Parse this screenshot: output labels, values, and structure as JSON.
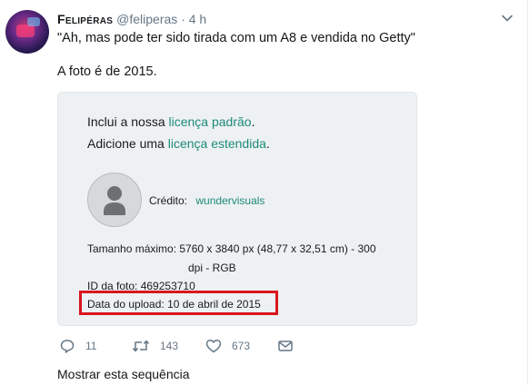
{
  "tweet": {
    "author_name": "Felipéras",
    "handle": "@feliperas",
    "separator": "·",
    "time": "4 h",
    "text_line1": "\"Ah, mas pode ter sido tirada com um A8 e vendida no Getty\"",
    "text_line2": "A foto é de 2015."
  },
  "card": {
    "license_line1_prefix": "Inclui a nossa ",
    "license_line1_link": "licença padrão",
    "license_line1_suffix": ".",
    "license_line2_prefix": "Adicione uma ",
    "license_line2_link": "licença estendida",
    "license_line2_suffix": ".",
    "credit_label": "Crédito:",
    "credit_value": "wundervisuals",
    "max_size_line1": "Tamanho máximo: 5760 x 3840 px (48,77 x 32,51 cm) - 300",
    "max_size_line2": "dpi - RGB",
    "photo_id": "ID da foto: 469253710",
    "upload_date": "Data do upload: 10 de abril de 2015"
  },
  "actions": {
    "reply_count": "11",
    "retweet_count": "143",
    "like_count": "673"
  },
  "show_thread": "Mostrar esta sequência",
  "colors": {
    "link_green": "#1d8a7a",
    "highlight_red": "#d9161e",
    "muted": "#657786"
  },
  "icons": [
    "reply-icon",
    "retweet-icon",
    "like-icon",
    "message-icon",
    "chevron-down-icon",
    "person-icon"
  ]
}
